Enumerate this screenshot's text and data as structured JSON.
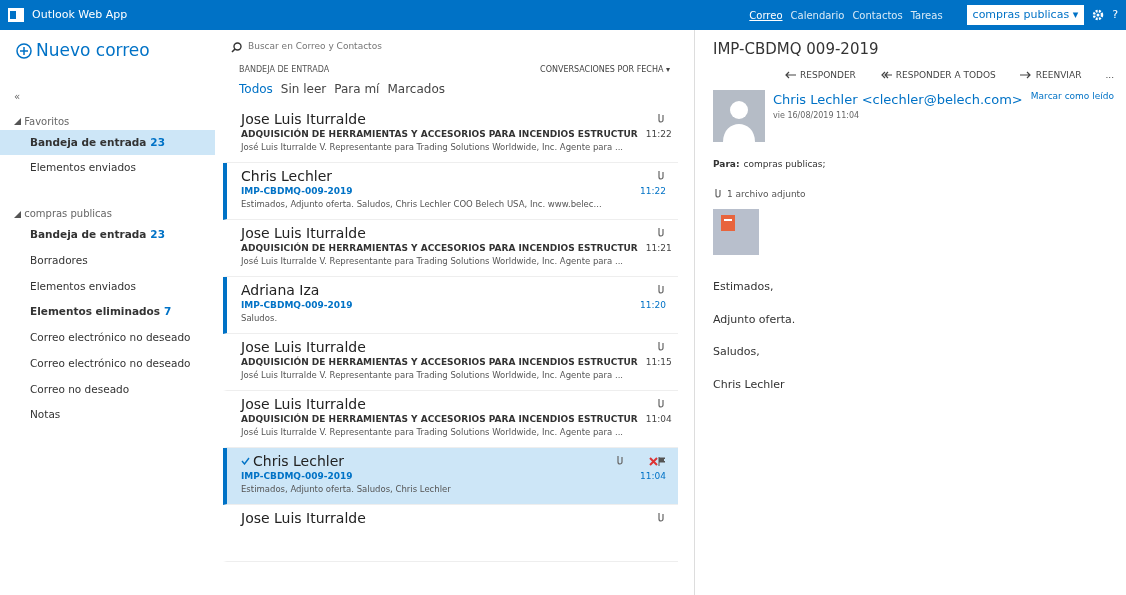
{
  "topbar": {
    "app_title": "Outlook Web App",
    "nav": [
      {
        "label": "Correo",
        "selected": true
      },
      {
        "label": "Calendario",
        "selected": false
      },
      {
        "label": "Contactos",
        "selected": false
      },
      {
        "label": "Tareas",
        "selected": false
      }
    ],
    "account": "compras publicas ▾",
    "help": "?"
  },
  "sidebar": {
    "new_mail": "Nuevo correo",
    "collapse": "«",
    "groups": [
      {
        "label": "Favoritos",
        "expanded": true,
        "items": [
          {
            "label": "Bandeja de entrada",
            "count": "23",
            "selected": true,
            "bold": true
          },
          {
            "label": "Elementos enviados",
            "selected": false,
            "bold": false
          }
        ]
      },
      {
        "label": "compras publicas",
        "expanded": true,
        "items": [
          {
            "label": "Bandeja de entrada",
            "count": "23",
            "selected": false,
            "bold": true
          },
          {
            "label": "Borradores",
            "selected": false,
            "bold": false
          },
          {
            "label": "Elementos enviados",
            "selected": false,
            "bold": false
          },
          {
            "label": "Elementos eliminados",
            "count": "7",
            "selected": false,
            "bold": true
          },
          {
            "label": "Correo electrónico no deseado",
            "selected": false,
            "bold": false
          },
          {
            "label": "Correo electrónico no deseado",
            "selected": false,
            "bold": false
          },
          {
            "label": "Correo no deseado",
            "selected": false,
            "bold": false
          },
          {
            "label": "Notas",
            "selected": false,
            "bold": false
          }
        ]
      }
    ]
  },
  "message_list": {
    "search": {
      "placeholder": "Buscar en Correo y Contactos"
    },
    "folder_title": "BANDEJA DE ENTRADA",
    "sort": "CONVERSACIONES POR FECHA ▾",
    "filters": [
      {
        "label": "Todos",
        "selected": true
      },
      {
        "label": "Sin leer",
        "selected": false
      },
      {
        "label": "Para mí",
        "selected": false
      },
      {
        "label": "Marcados",
        "selected": false
      }
    ],
    "messages": [
      {
        "sender": "Jose Luis Iturralde",
        "subject": "ADQUISICIÓN DE HERRAMIENTAS Y ACCESORIOS PARA INCENDIOS ESTRUCTUR",
        "preview": "José Luis Iturralde V. Representante para Trading Solutions Worldwide, Inc. Agente para ...",
        "time": "11:22",
        "unread": false,
        "selected": false
      },
      {
        "sender": "Chris Lechler",
        "subject": "IMP-CBDMQ-009-2019",
        "preview": "Estimados, Adjunto oferta. Saludos, Chris Lechler COO Belech USA, Inc. www.belec...",
        "time": "11:22",
        "unread": true,
        "selected": false
      },
      {
        "sender": "Jose Luis Iturralde",
        "subject": "ADQUISICIÓN DE HERRAMIENTAS Y ACCESORIOS PARA INCENDIOS ESTRUCTUR",
        "preview": "José Luis Iturralde V. Representante para Trading Solutions Worldwide, Inc. Agente para ...",
        "time": "11:21",
        "unread": false,
        "selected": false
      },
      {
        "sender": "Adriana Iza",
        "subject": "IMP-CBDMQ-009-2019",
        "preview": "Saludos.",
        "time": "11:20",
        "unread": true,
        "selected": false
      },
      {
        "sender": "Jose Luis Iturralde",
        "subject": "ADQUISICIÓN DE HERRAMIENTAS Y ACCESORIOS PARA INCENDIOS ESTRUCTUR",
        "preview": "José Luis Iturralde V. Representante para Trading Solutions Worldwide, Inc. Agente para ...",
        "time": "11:15",
        "unread": false,
        "selected": false
      },
      {
        "sender": "Jose Luis Iturralde",
        "subject": "ADQUISICIÓN DE HERRAMIENTAS Y ACCESORIOS PARA INCENDIOS ESTRUCTUR",
        "preview": "José Luis Iturralde V. Representante para Trading Solutions Worldwide, Inc. Agente para ...",
        "time": "11:04",
        "unread": false,
        "selected": false
      },
      {
        "sender": "Chris Lechler",
        "subject": "IMP-CBDMQ-009-2019",
        "preview": "Estimados, Adjunto oferta. Saludos, Chris Lechler",
        "time": "11:04",
        "unread": true,
        "selected": true
      },
      {
        "sender": "Jose Luis Iturralde",
        "unread": false,
        "selected": false
      }
    ]
  },
  "reading_pane": {
    "subject": "IMP-CBDMQ 009-2019",
    "actions": [
      "RESPONDER",
      "RESPONDER A TODOS",
      "REENVIAR"
    ],
    "more": "...",
    "sender": "Chris Lechler <clechler@belech.com>",
    "date": "vie 16/08/2019 11:04",
    "mark_read": "Marcar como leído",
    "to_label": "Para:",
    "to": "compras publicas;",
    "attachments_label": "1 archivo adjunto",
    "body": [
      "Estimados,",
      "Adjunto oferta.",
      "Saludos,",
      "Chris Lechler"
    ]
  }
}
